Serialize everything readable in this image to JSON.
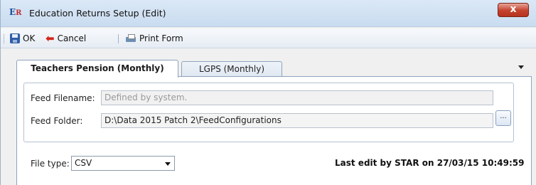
{
  "window": {
    "title": "Education Returns Setup (Edit)",
    "app_icon_text": "E",
    "app_icon_text_r": "R",
    "close_label": "x"
  },
  "toolbar": {
    "ok_label": "OK",
    "cancel_label": "Cancel",
    "print_label": "Print Form"
  },
  "tabs": [
    {
      "label": "Teachers Pension (Monthly)",
      "active": true
    },
    {
      "label": "LGPS (Monthly)",
      "active": false
    }
  ],
  "feed": {
    "filename_label": "Feed Filename:",
    "filename_value": "Defined by system.",
    "folder_label": "Feed Folder:",
    "folder_value": "D:\\Data 2015 Patch 2\\FeedConfigurations",
    "browse_label": "..."
  },
  "file_type": {
    "label": "File type:",
    "selected": "CSV"
  },
  "status": {
    "last_edit": "Last edit by STAR on 27/03/15 10:49:59"
  },
  "icons": {
    "app": "education-returns-icon",
    "save": "floppy-disk-icon",
    "cancel": "back-arrow-icon",
    "print": "printer-icon"
  },
  "colors": {
    "close_button": "#c4412c",
    "cancel_arrow": "#d3251b",
    "titlebar": "#c9dcf0"
  }
}
